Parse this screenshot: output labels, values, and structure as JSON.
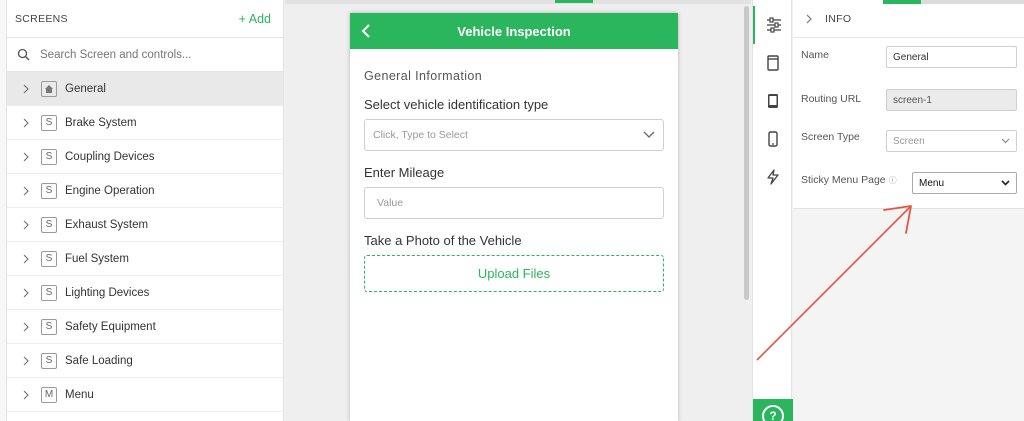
{
  "screens_panel": {
    "title": "SCREENS",
    "add_label": "+ Add",
    "search_placeholder": "Search Screen and controls...",
    "items": [
      {
        "label": "General",
        "badge": "home",
        "active": true
      },
      {
        "label": "Brake System",
        "badge": "S"
      },
      {
        "label": "Coupling Devices",
        "badge": "S"
      },
      {
        "label": "Engine Operation",
        "badge": "S"
      },
      {
        "label": "Exhaust System",
        "badge": "S"
      },
      {
        "label": "Fuel System",
        "badge": "S"
      },
      {
        "label": "Lighting Devices",
        "badge": "S"
      },
      {
        "label": "Safety Equipment",
        "badge": "S"
      },
      {
        "label": "Safe Loading",
        "badge": "S"
      },
      {
        "label": "Menu",
        "badge": "M"
      }
    ]
  },
  "phone": {
    "title": "Vehicle Inspection",
    "section_title": "General Information",
    "field1_label": "Select vehicle identification type",
    "field1_placeholder": "Click, Type to Select",
    "field2_label": "Enter Mileage",
    "field2_placeholder": "Value",
    "field3_label": "Take a Photo of the Vehicle",
    "upload_label": "Upload Files"
  },
  "rail": {
    "icons": [
      "sliders-icon",
      "page-icon",
      "tablet-icon",
      "mobile-icon",
      "lightning-icon"
    ],
    "help_label": "?"
  },
  "properties": {
    "section_title": "INFO",
    "name_label": "Name",
    "name_value": "General",
    "routing_label": "Routing URL",
    "routing_value": "screen-1",
    "screen_type_label": "Screen Type",
    "screen_type_value": "Screen",
    "sticky_label": "Sticky Menu Page",
    "sticky_info": "ⓘ",
    "sticky_value": "Menu"
  },
  "colors": {
    "accent": "#2bb55c",
    "annotation_arrow": "#e8533f"
  }
}
